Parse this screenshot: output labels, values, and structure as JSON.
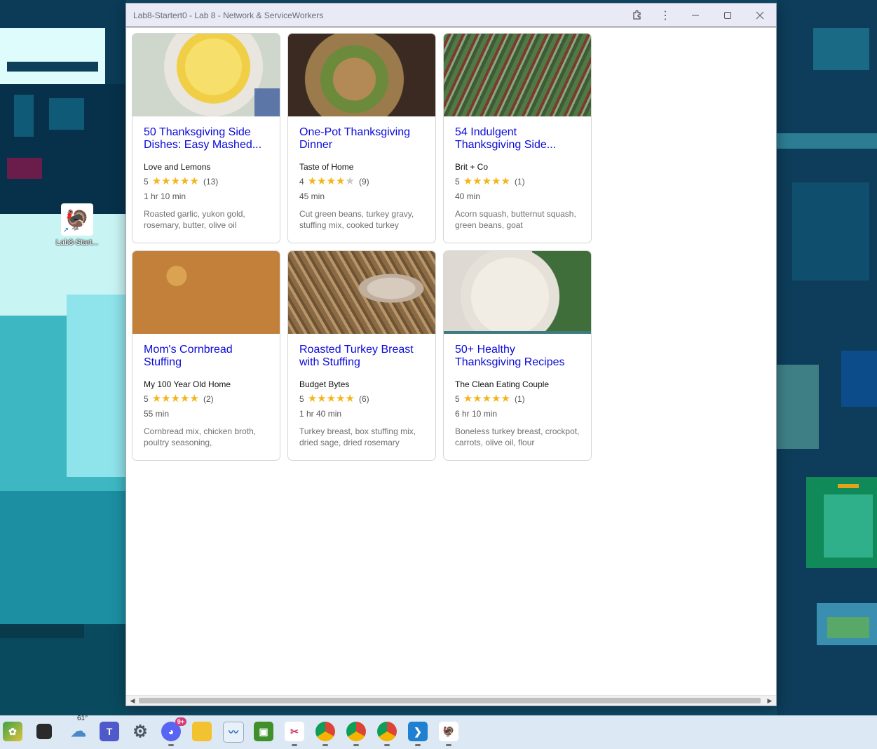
{
  "window": {
    "title": "Lab8-Startert0 - Lab 8 - Network & ServiceWorkers",
    "controls": {
      "extensions_icon": "puzzle-icon",
      "menu_icon": "kebab-menu-icon",
      "minimize": "—",
      "maximize": "☐",
      "close": "✕"
    }
  },
  "desktop": {
    "shortcut_label": "Lab8-Start..."
  },
  "recipes": [
    {
      "title": "50 Thanksgiving Side Dishes: Easy Mashed...",
      "org": "Love and Lemons",
      "rating": "5",
      "stars": 5,
      "count": "(13)",
      "time": "1 hr 10 min",
      "ingredients": "Roasted garlic, yukon gold, rosemary, butter, olive oil"
    },
    {
      "title": "One-Pot Thanksgiving Dinner",
      "org": "Taste of Home",
      "rating": "4",
      "stars": 4,
      "count": "(9)",
      "time": "45 min",
      "ingredients": "Cut green beans, turkey gravy, stuffing mix, cooked turkey"
    },
    {
      "title": "54 Indulgent Thanksgiving Side...",
      "org": "Brit + Co",
      "rating": "5",
      "stars": 5,
      "count": "(1)",
      "time": "40 min",
      "ingredients": "Acorn squash, butternut squash, green beans, goat"
    },
    {
      "title": "Mom's Cornbread Stuffing",
      "org": "My 100 Year Old Home",
      "rating": "5",
      "stars": 5,
      "count": "(2)",
      "time": "55 min",
      "ingredients": "Cornbread mix, chicken broth, poultry seasoning,"
    },
    {
      "title": "Roasted Turkey Breast with Stuffing",
      "org": "Budget Bytes",
      "rating": "5",
      "stars": 5,
      "count": "(6)",
      "time": "1 hr 40 min",
      "ingredients": "Turkey breast, box stuffing mix, dried sage, dried rosemary"
    },
    {
      "title": "50+ Healthy Thanksgiving Recipes",
      "org": "The Clean Eating Couple",
      "rating": "5",
      "stars": 5,
      "count": "(1)",
      "time": "6 hr 10 min",
      "ingredients": "Boneless turkey breast, crockpot, carrots, olive oil, flour"
    }
  ],
  "taskbar": {
    "weather_temp": "61°",
    "discord_badge": "9+",
    "apps": [
      "widgets-icon",
      "task-view-icon",
      "weather-icon",
      "teams-icon",
      "settings-icon",
      "discord-icon",
      "file-explorer-icon",
      "performance-monitor-icon",
      "minecraft-icon",
      "snipping-tool-icon",
      "chrome-icon",
      "chrome-icon",
      "chrome-icon",
      "vscode-icon",
      "pwa-app-icon"
    ]
  }
}
